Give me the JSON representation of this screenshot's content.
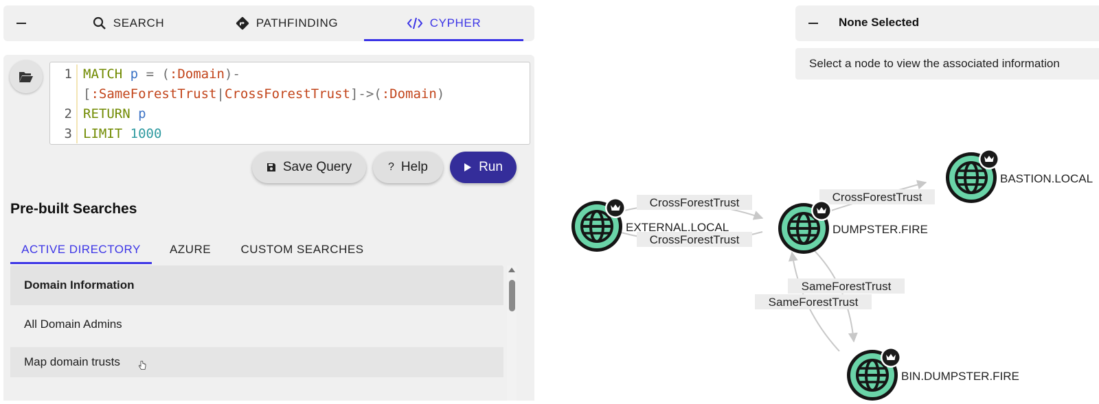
{
  "tabs": {
    "search": "SEARCH",
    "pathfinding": "PATHFINDING",
    "cypher": "CYPHER"
  },
  "editor": {
    "line_numbers": [
      "1",
      "2",
      "3"
    ],
    "query_lines": [
      "MATCH p = (:Domain)-[:SameForestTrust|CrossForestTrust]->(:Domain)",
      "RETURN p",
      "LIMIT 1000"
    ]
  },
  "buttons": {
    "save_query": "Save Query",
    "help": "Help",
    "run": "Run"
  },
  "prebuilt": {
    "title": "Pre-built Searches",
    "tabs": [
      "ACTIVE DIRECTORY",
      "AZURE",
      "CUSTOM SEARCHES"
    ],
    "active_tab": "ACTIVE DIRECTORY",
    "items": [
      "Domain Information",
      "All Domain Admins",
      "Map domain trusts"
    ]
  },
  "info_panel": {
    "title": "None Selected",
    "message": "Select a node to view the associated information"
  },
  "graph": {
    "nodes": [
      "EXTERNAL.LOCAL",
      "DUMPSTER.FIRE",
      "BASTION.LOCAL",
      "BIN.DUMPSTER.FIRE"
    ],
    "edges": [
      {
        "from": "EXTERNAL.LOCAL",
        "to": "DUMPSTER.FIRE",
        "label": "CrossForestTrust"
      },
      {
        "from": "DUMPSTER.FIRE",
        "to": "EXTERNAL.LOCAL",
        "label": "CrossForestTrust"
      },
      {
        "from": "DUMPSTER.FIRE",
        "to": "BASTION.LOCAL",
        "label": "CrossForestTrust"
      },
      {
        "from": "DUMPSTER.FIRE",
        "to": "BIN.DUMPSTER.FIRE",
        "label": "SameForestTrust"
      },
      {
        "from": "BIN.DUMPSTER.FIRE",
        "to": "DUMPSTER.FIRE",
        "label": "SameForestTrust"
      }
    ],
    "node_color": "#6ad4a8",
    "accent": "#3b34e6",
    "run_color": "#342d9a"
  }
}
